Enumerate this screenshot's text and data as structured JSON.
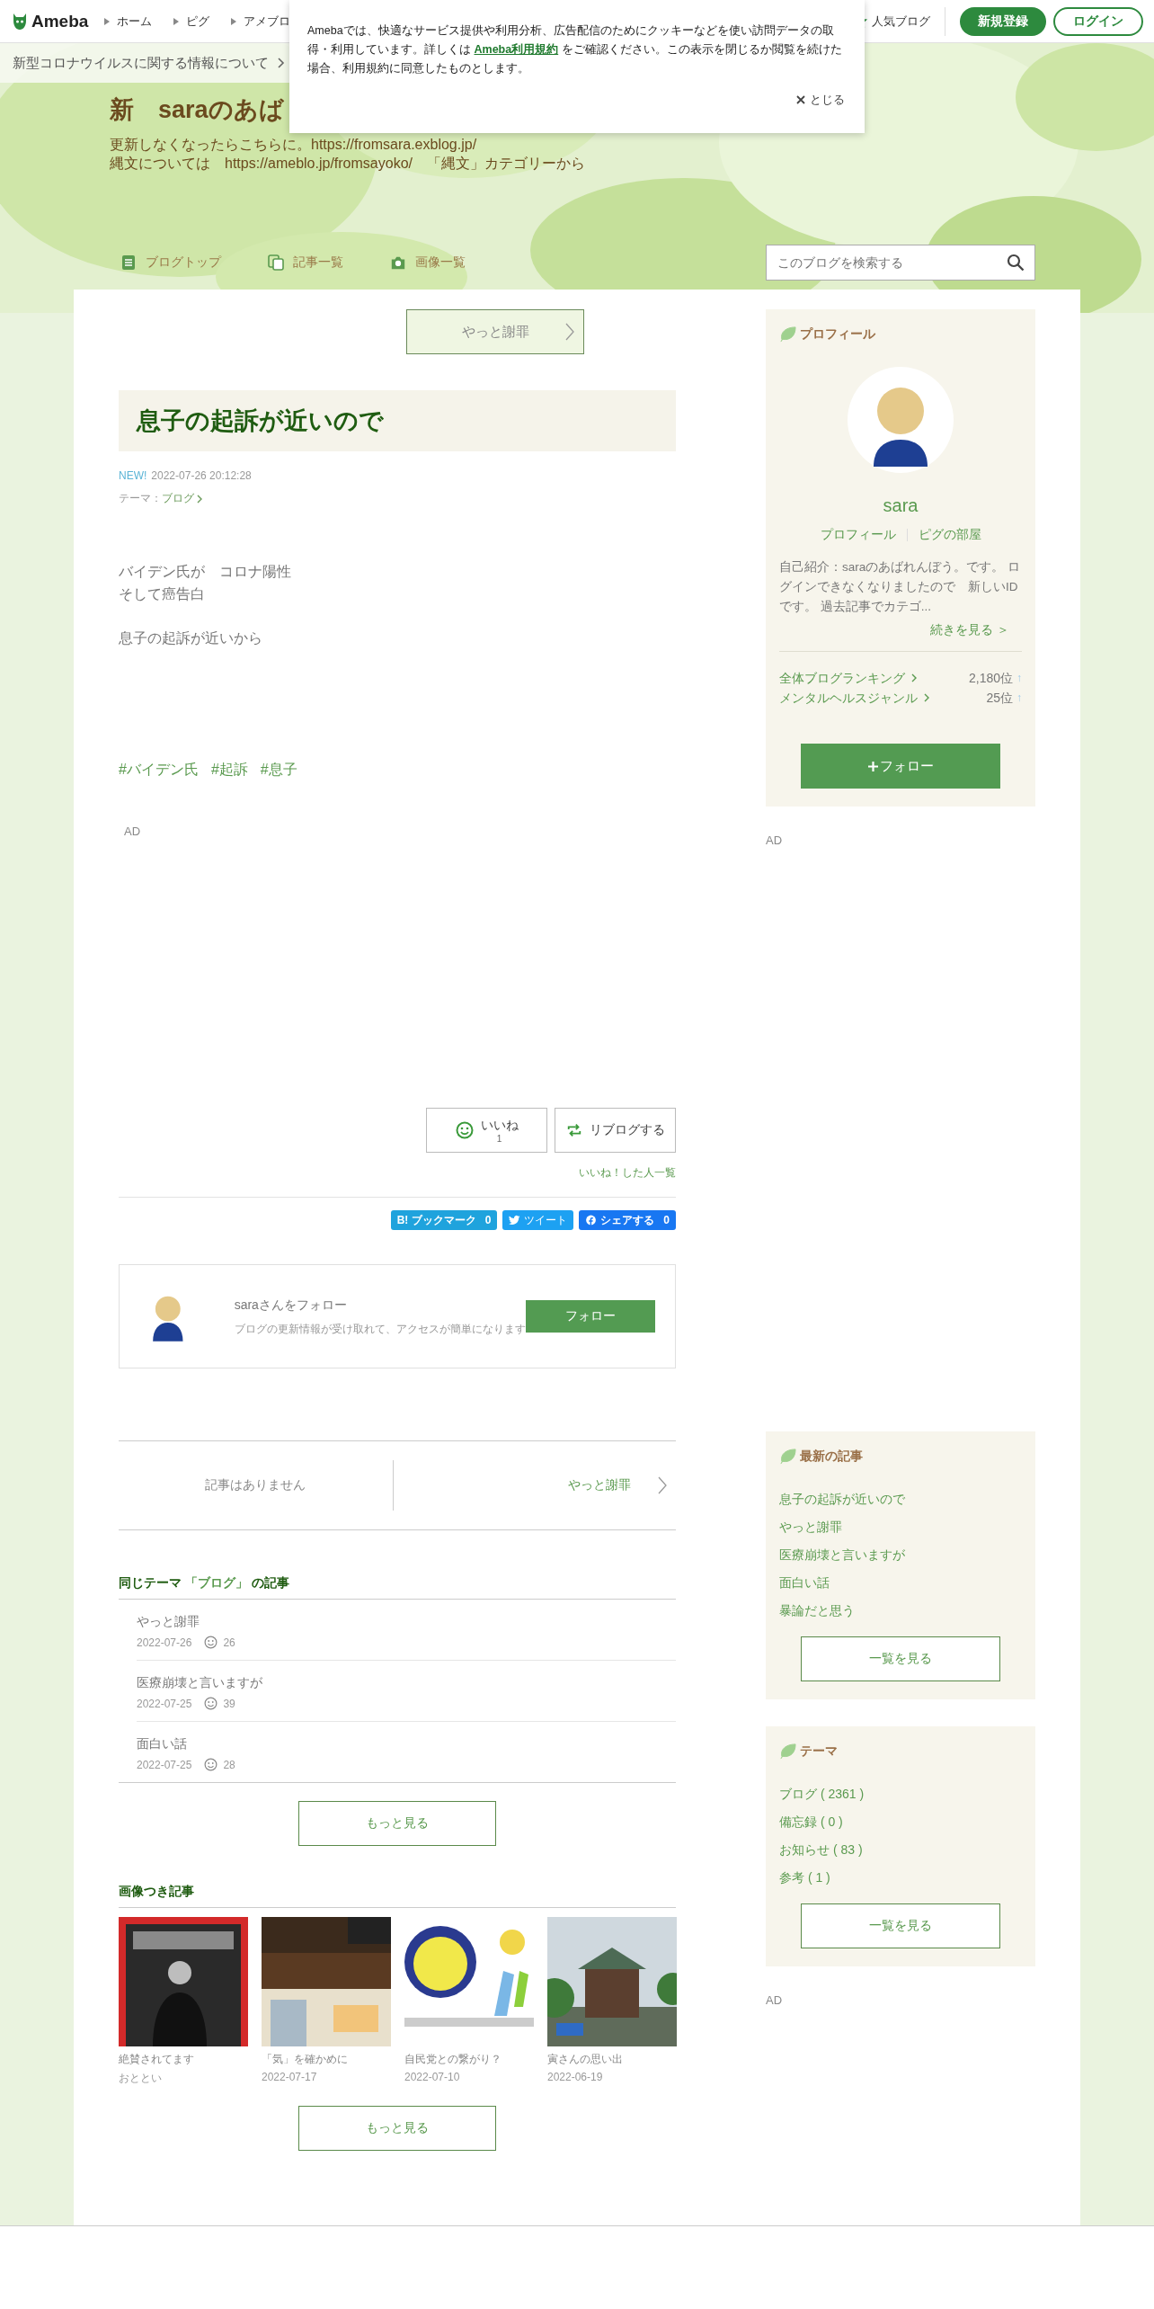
{
  "global_header": {
    "logo": "Ameba",
    "nav": [
      "ホーム",
      "ピグ",
      "アメブロ"
    ],
    "popular": "人気ブログ",
    "signup": "新規登録",
    "login": "ログイン"
  },
  "notice_bar": {
    "text": "新型コロナウイルスに関する情報について"
  },
  "cookie_popup": {
    "text_before": "Amebaでは、快適なサービス提供や利用分析、広告配信のためにクッキーなどを使い訪問データの取得・利用しています。詳しくは ",
    "link": "Ameba利用規約",
    "text_after": " をご確認ください。この表示を閉じるか閲覧を続けた場合、利用規約に同意したものとします。",
    "close": "とじる"
  },
  "blog_header": {
    "title": "新　saraのあば",
    "description": [
      "更新しなくなったらこちらに。https://fromsara.exblog.jp/",
      "縄文については　https://ameblo.jp/fromsayoko/　「縄文」カテゴリーから"
    ]
  },
  "blog_nav": [
    {
      "kind": "top",
      "label": "ブログトップ"
    },
    {
      "kind": "list",
      "label": "記事一覧"
    },
    {
      "kind": "images",
      "label": "画像一覧"
    }
  ],
  "search": {
    "placeholder": "このブログを検索する"
  },
  "article": {
    "prev_button": "やっと謝罪",
    "title": "息子の起訴が近いので",
    "new_badge": "NEW!",
    "date": "2022-07-26 20:12:28",
    "theme_label": "テーマ：",
    "theme": "ブログ",
    "body": [
      [
        "バイデン氏が　コロナ陽性",
        "そして癌告白"
      ],
      [
        "息子の起訴が近いから"
      ]
    ],
    "hashtags": [
      "#バイデン氏",
      "#起訴",
      "#息子"
    ],
    "ad": "AD",
    "like": {
      "label": "いいね",
      "count": "1"
    },
    "reblog": "リブログする",
    "likers": "いいね！した人一覧",
    "share": [
      {
        "kind": "hatena",
        "label": "B! ブックマーク",
        "count": "0"
      },
      {
        "kind": "twitter",
        "label": "ツイート"
      },
      {
        "kind": "facebook",
        "label": "シェアする",
        "count": "0"
      }
    ],
    "follow_card": {
      "title": "saraさんをフォロー",
      "text": "ブログの更新情報が受け取れて、アクセスが簡単になります",
      "button": "フォロー"
    }
  },
  "pager": {
    "prev": "記事はありません",
    "next": "やっと謝罪"
  },
  "same_theme": {
    "heading_prefix": "同じテーマ",
    "heading_theme": "「ブログ」",
    "heading_suffix": "の記事",
    "items": [
      {
        "title": "やっと謝罪",
        "date": "2022-07-26",
        "likes": "26"
      },
      {
        "title": "医療崩壊と言いますが",
        "date": "2022-07-25",
        "likes": "39"
      },
      {
        "title": "面白い話",
        "date": "2022-07-25",
        "likes": "28"
      }
    ],
    "more": "もっと見る"
  },
  "image_articles": {
    "heading": "画像つき記事",
    "items": [
      {
        "title": "絶賛されてます",
        "date": "おととい"
      },
      {
        "title": "「気」を確かめに",
        "date": "2022-07-17"
      },
      {
        "title": "自民党との繋がり？",
        "date": "2022-07-10"
      },
      {
        "title": "寅さんの思い出",
        "date": "2022-06-19"
      }
    ],
    "more": "もっと見る"
  },
  "sidebar": {
    "profile": {
      "heading": "プロフィール",
      "name": "sara",
      "links": [
        "プロフィール",
        "ピグの部屋"
      ],
      "intro": "自己紹介：saraのあばれんぼう。です。 ログインできなくなりましたので　新しいIDです。 過去記事でカテゴ...",
      "more": "続きを見る ＞",
      "rankings": [
        {
          "label": "全体ブログランキング",
          "value": "2,180位",
          "trend": "↑"
        },
        {
          "label": "メンタルヘルスジャンル",
          "value": "25位",
          "trend": "↑"
        }
      ],
      "follow": "フォロー"
    },
    "ad": "AD",
    "recent": {
      "heading": "最新の記事",
      "items": [
        "息子の起訴が近いので",
        "やっと謝罪",
        "医療崩壊と言いますが",
        "面白い話",
        "暴論だと思う"
      ],
      "more": "一覧を見る"
    },
    "themes": {
      "heading": "テーマ",
      "items": [
        "ブログ ( 2361 )",
        "備忘録 ( 0 )",
        "お知らせ ( 83 )",
        "参考 ( 1 )"
      ],
      "more": "一覧を見る"
    },
    "ad2": "AD"
  }
}
